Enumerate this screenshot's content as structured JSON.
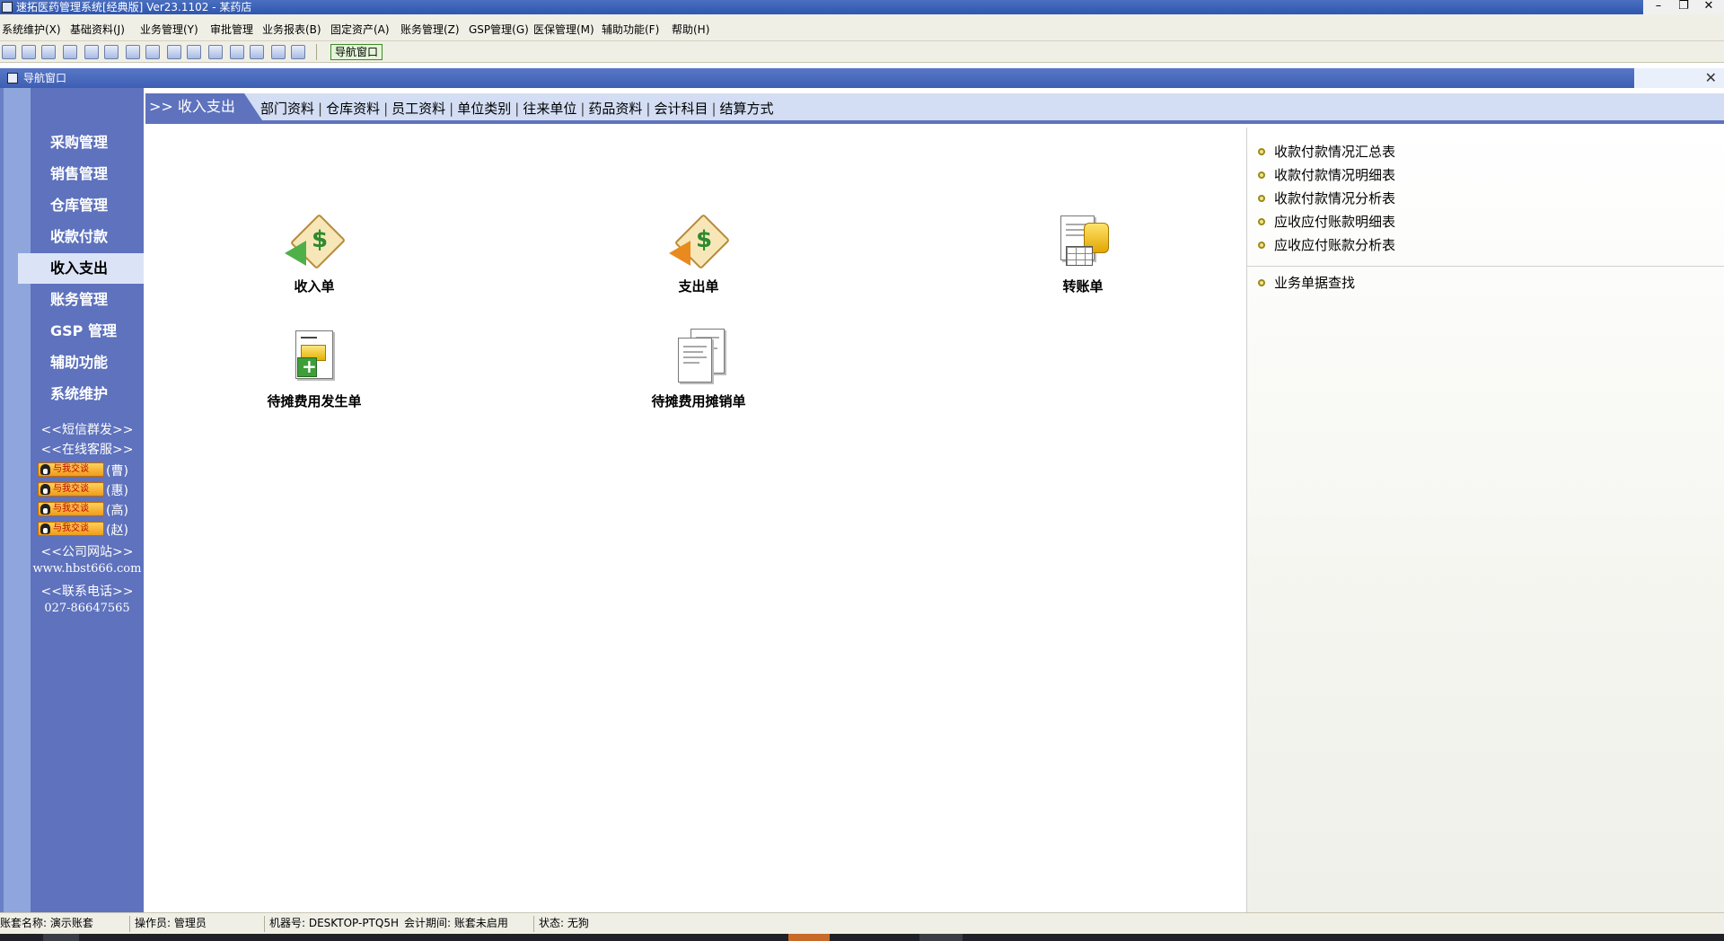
{
  "window": {
    "title": "速拓医药管理系统[经典版] Ver23.1102  -  某药店",
    "minimize": "–",
    "restore": "❐",
    "close": "✕"
  },
  "menu": [
    "系统维护(X)",
    "基础资料(J)",
    "业务管理(Y)",
    "审批管理",
    "业务报表(B)",
    "固定资产(A)",
    "账务管理(Z)",
    "GSP管理(G)",
    "医保管理(M)",
    "辅助功能(F)",
    "帮助(H)"
  ],
  "toolbar": {
    "nav_button": "导航窗口"
  },
  "nav_window": {
    "title": "导航窗口",
    "close": "✕"
  },
  "sidebar": {
    "items": [
      "采购管理",
      "销售管理",
      "仓库管理",
      "收款付款",
      "收入支出",
      "账务管理",
      "GSP 管理",
      "辅助功能",
      "系统维护"
    ],
    "active_index": 4,
    "sms": "<<短信群发>>",
    "service": "<<在线客服>>",
    "qq": [
      {
        "badge": "与我交谈",
        "name": "(曹)"
      },
      {
        "badge": "与我交谈",
        "name": "(惠)"
      },
      {
        "badge": "与我交谈",
        "name": "(高)"
      },
      {
        "badge": "与我交谈",
        "name": "(赵)"
      }
    ],
    "website_label": "<<公司网站>>",
    "website": "www.hbst666.com",
    "phone_label": "<<联系电话>>",
    "phone": "027-86647565"
  },
  "tabbar": {
    "current": ">> 收入支出",
    "links": [
      "部门资料",
      "仓库资料",
      "员工资料",
      "单位类别",
      "往来单位",
      "药品资料",
      "会计科目",
      "结算方式"
    ],
    "separator": "|"
  },
  "functions": {
    "income": "收入单",
    "expense": "支出单",
    "transfer": "转账单",
    "deferred_occur": "待摊费用发生单",
    "deferred_amortize": "待摊费用摊销单"
  },
  "right_panel": {
    "reports": [
      "收款付款情况汇总表",
      "收款付款情况明细表",
      "收款付款情况分析表",
      "应收应付账款明细表",
      "应收应付账款分析表"
    ],
    "search": "业务单据查找"
  },
  "status": {
    "account": "账套名称:  演示账套",
    "operator": "操作员:  管理员",
    "machine": "机器号:  DESKTOP-PTQ5H",
    "period": "会计期间:  账套未启用",
    "state": "状态:  无狗"
  },
  "colors": {
    "titlebar": "#3a5fb8",
    "sidebar": "#5e72bd",
    "sidebar_active": "#dbe4f6",
    "tabbar": "#d3def4",
    "bullet": "#f1e48a"
  }
}
